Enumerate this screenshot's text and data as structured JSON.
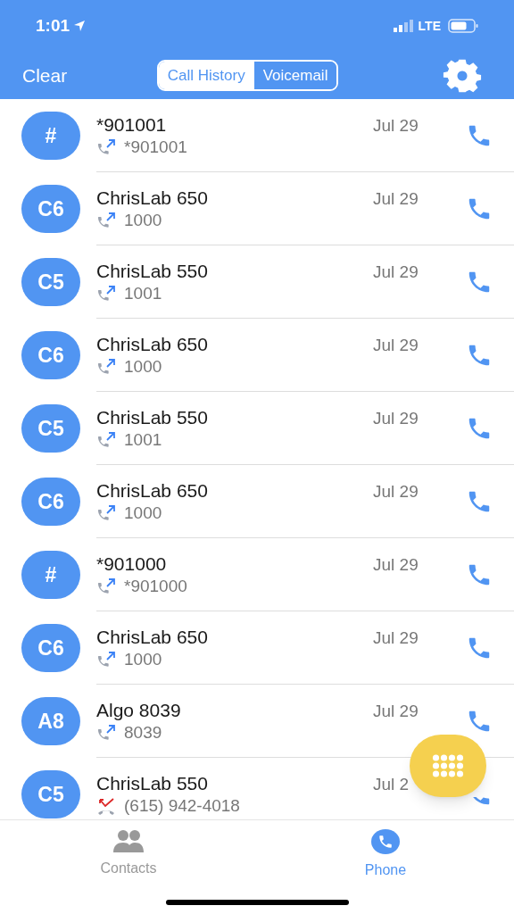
{
  "status_bar": {
    "time": "1:01",
    "network": "LTE"
  },
  "header": {
    "clear": "Clear",
    "segments": [
      {
        "label": "Call History",
        "selected": true
      },
      {
        "label": "Voicemail",
        "selected": false
      }
    ]
  },
  "calls": [
    {
      "initials": "#",
      "name": "*901001",
      "number": "*901001",
      "date": "Jul 29",
      "kind": "outgoing"
    },
    {
      "initials": "C6",
      "name": "ChrisLab 650",
      "number": "1000",
      "date": "Jul 29",
      "kind": "outgoing"
    },
    {
      "initials": "C5",
      "name": "ChrisLab 550",
      "number": "1001",
      "date": "Jul 29",
      "kind": "outgoing"
    },
    {
      "initials": "C6",
      "name": "ChrisLab 650",
      "number": "1000",
      "date": "Jul 29",
      "kind": "outgoing"
    },
    {
      "initials": "C5",
      "name": "ChrisLab 550",
      "number": "1001",
      "date": "Jul 29",
      "kind": "outgoing"
    },
    {
      "initials": "C6",
      "name": "ChrisLab 650",
      "number": "1000",
      "date": "Jul 29",
      "kind": "outgoing"
    },
    {
      "initials": "#",
      "name": "*901000",
      "number": "*901000",
      "date": "Jul 29",
      "kind": "outgoing"
    },
    {
      "initials": "C6",
      "name": "ChrisLab 650",
      "number": "1000",
      "date": "Jul 29",
      "kind": "outgoing"
    },
    {
      "initials": "A8",
      "name": "Algo 8039",
      "number": "8039",
      "date": "Jul 29",
      "kind": "outgoing"
    },
    {
      "initials": "C5",
      "name": "ChrisLab 550",
      "number": "(615) 942-4018",
      "date": "Jul 2",
      "kind": "missed"
    }
  ],
  "tab_bar": [
    {
      "label": "Contacts",
      "selected": false,
      "kind": "contacts"
    },
    {
      "label": "Phone",
      "selected": true,
      "kind": "phone"
    }
  ]
}
